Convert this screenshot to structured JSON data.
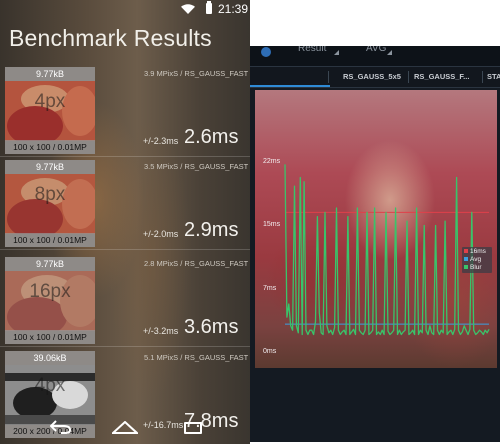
{
  "left_screen": {
    "status_bar": {
      "time": "21:39"
    },
    "title": "Benchmark Results",
    "rows": [
      {
        "size": "9.77kB",
        "radius": "4px",
        "dims": "100 x 100 / 0.01MP",
        "meta": "3.9 MPixS / RS_GAUSS_FAST",
        "error": "+/-2.3ms",
        "time": "2.6ms"
      },
      {
        "size": "9.77kB",
        "radius": "8px",
        "dims": "100 x 100 / 0.01MP",
        "meta": "3.5 MPixS / RS_GAUSS_FAST",
        "error": "+/-2.0ms",
        "time": "2.9ms"
      },
      {
        "size": "9.77kB",
        "radius": "16px",
        "dims": "100 x 100 / 0.01MP",
        "meta": "2.8 MPixS / RS_GAUSS_FAST",
        "error": "+/-3.2ms",
        "time": "3.6ms"
      },
      {
        "size": "39.06kB",
        "radius": "4px",
        "dims": "200 x 200 / 0.04MP",
        "meta": "5.1 MPixS / RS_GAUSS_FAST",
        "error": "+/-16.7ms",
        "time": "7.8ms"
      }
    ]
  },
  "right_screen": {
    "toolbar": {
      "spinner_1": "Result",
      "spinner_2": "AVG"
    },
    "tabs": [
      "RS_GAUSS_5x5",
      "RS_GAUSS_F...",
      "STA"
    ],
    "colors": {
      "accent": "#2f8bd6",
      "line_16ms": "#e0404a",
      "line_avg": "#3aa0e0",
      "line_blur": "#39c46a"
    },
    "chart_data": {
      "type": "line",
      "y_ticks": [
        "22ms",
        "15ms",
        "7ms",
        "0ms"
      ],
      "ylim": [
        0,
        22
      ],
      "grid": false,
      "legend_position": "right",
      "series": [
        {
          "name": "16ms",
          "values": [
            16,
            16
          ]
        },
        {
          "name": "Avg",
          "values": [
            3.2,
            3.2
          ]
        },
        {
          "name": "Blur",
          "values": [
            21.5,
            4,
            5.5,
            3,
            2.5,
            19,
            3,
            2.2,
            20,
            2,
            19.5,
            2.5,
            2,
            2.5,
            2.5,
            2,
            3.5,
            15.5,
            4.5,
            2.2,
            2,
            16,
            3,
            2.2,
            2.5,
            2,
            2.8,
            16.5,
            2.5,
            2,
            2.3,
            2.5,
            2,
            15.5,
            2,
            2.3,
            2.6,
            2,
            16.5,
            2.5,
            2.2,
            2,
            2.5,
            16,
            2,
            2.2,
            2.5,
            16.5,
            2,
            2.3,
            2,
            2.5,
            2,
            16,
            2.4,
            2,
            2.2,
            2.5,
            16.5,
            2,
            2.5,
            2,
            2.3,
            2.5,
            15,
            2,
            2.2,
            2.5,
            2,
            16.5,
            2,
            2.5,
            2.2,
            14.5,
            2.5,
            2,
            3,
            2.2,
            2,
            14.5,
            2.5,
            2,
            2.5,
            2.2,
            15,
            2,
            2.3,
            2.5,
            2,
            2.6,
            20,
            2.5,
            2,
            2.3,
            3,
            2.5,
            2,
            2.6,
            16,
            2.5,
            2,
            2.2,
            2.5,
            2.3,
            2,
            2.5,
            2.2,
            2.6
          ]
        }
      ]
    }
  }
}
